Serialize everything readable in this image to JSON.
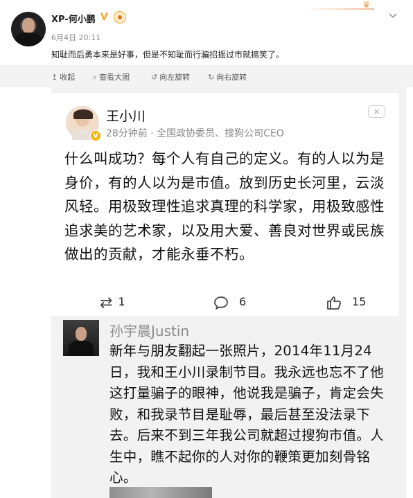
{
  "post": {
    "username": "XP-何小鹏",
    "verified_mark": "V",
    "timestamp": "6月4日 20:11",
    "text": "知耻而后勇本来是好事，但是不知耻而行骗招摇过市就搞笑了。",
    "more_icon": "chevron-down-icon"
  },
  "toolbar": {
    "collapse_label": "收起",
    "view_large_label": "查看大图",
    "rotate_left_label": "向左旋转",
    "rotate_right_label": "向右旋转"
  },
  "screenshot": {
    "wang": {
      "name": "王小川",
      "meta": "28分钟前 · 全国政协委员、搜狗公司CEO",
      "close_label": "×",
      "text": "什么叫成功？每个人有自己的定义。有的人以为是身价，有的人以为是市值。放到历史长河里，云淡风轻。用极致理性追求真理的科学家，用极致感性追求美的艺术家，以及用大爱、善良对世界或民族做出的贡献，才能永垂不朽。",
      "reposts": "1",
      "comments": "6",
      "likes": "15"
    },
    "sun": {
      "name": "孙宇晨Justin",
      "text": "新年与朋友翻起一张照片，2014年11月24日，我和王小川录制节目。我永远也忘不了他这打量骗子的眼神，他说我是骗子，肯定会失败，和我录节目是耻辱，最后甚至没法录下去。后来不到三年我公司就超过搜狗市值。人生中，瞧不起你的人对你的鞭策更加刻骨铭心。"
    }
  },
  "colors": {
    "verified_gold": "#f5a623",
    "toolbar_bg": "#f3f3f3",
    "meta_gray": "#888888"
  }
}
